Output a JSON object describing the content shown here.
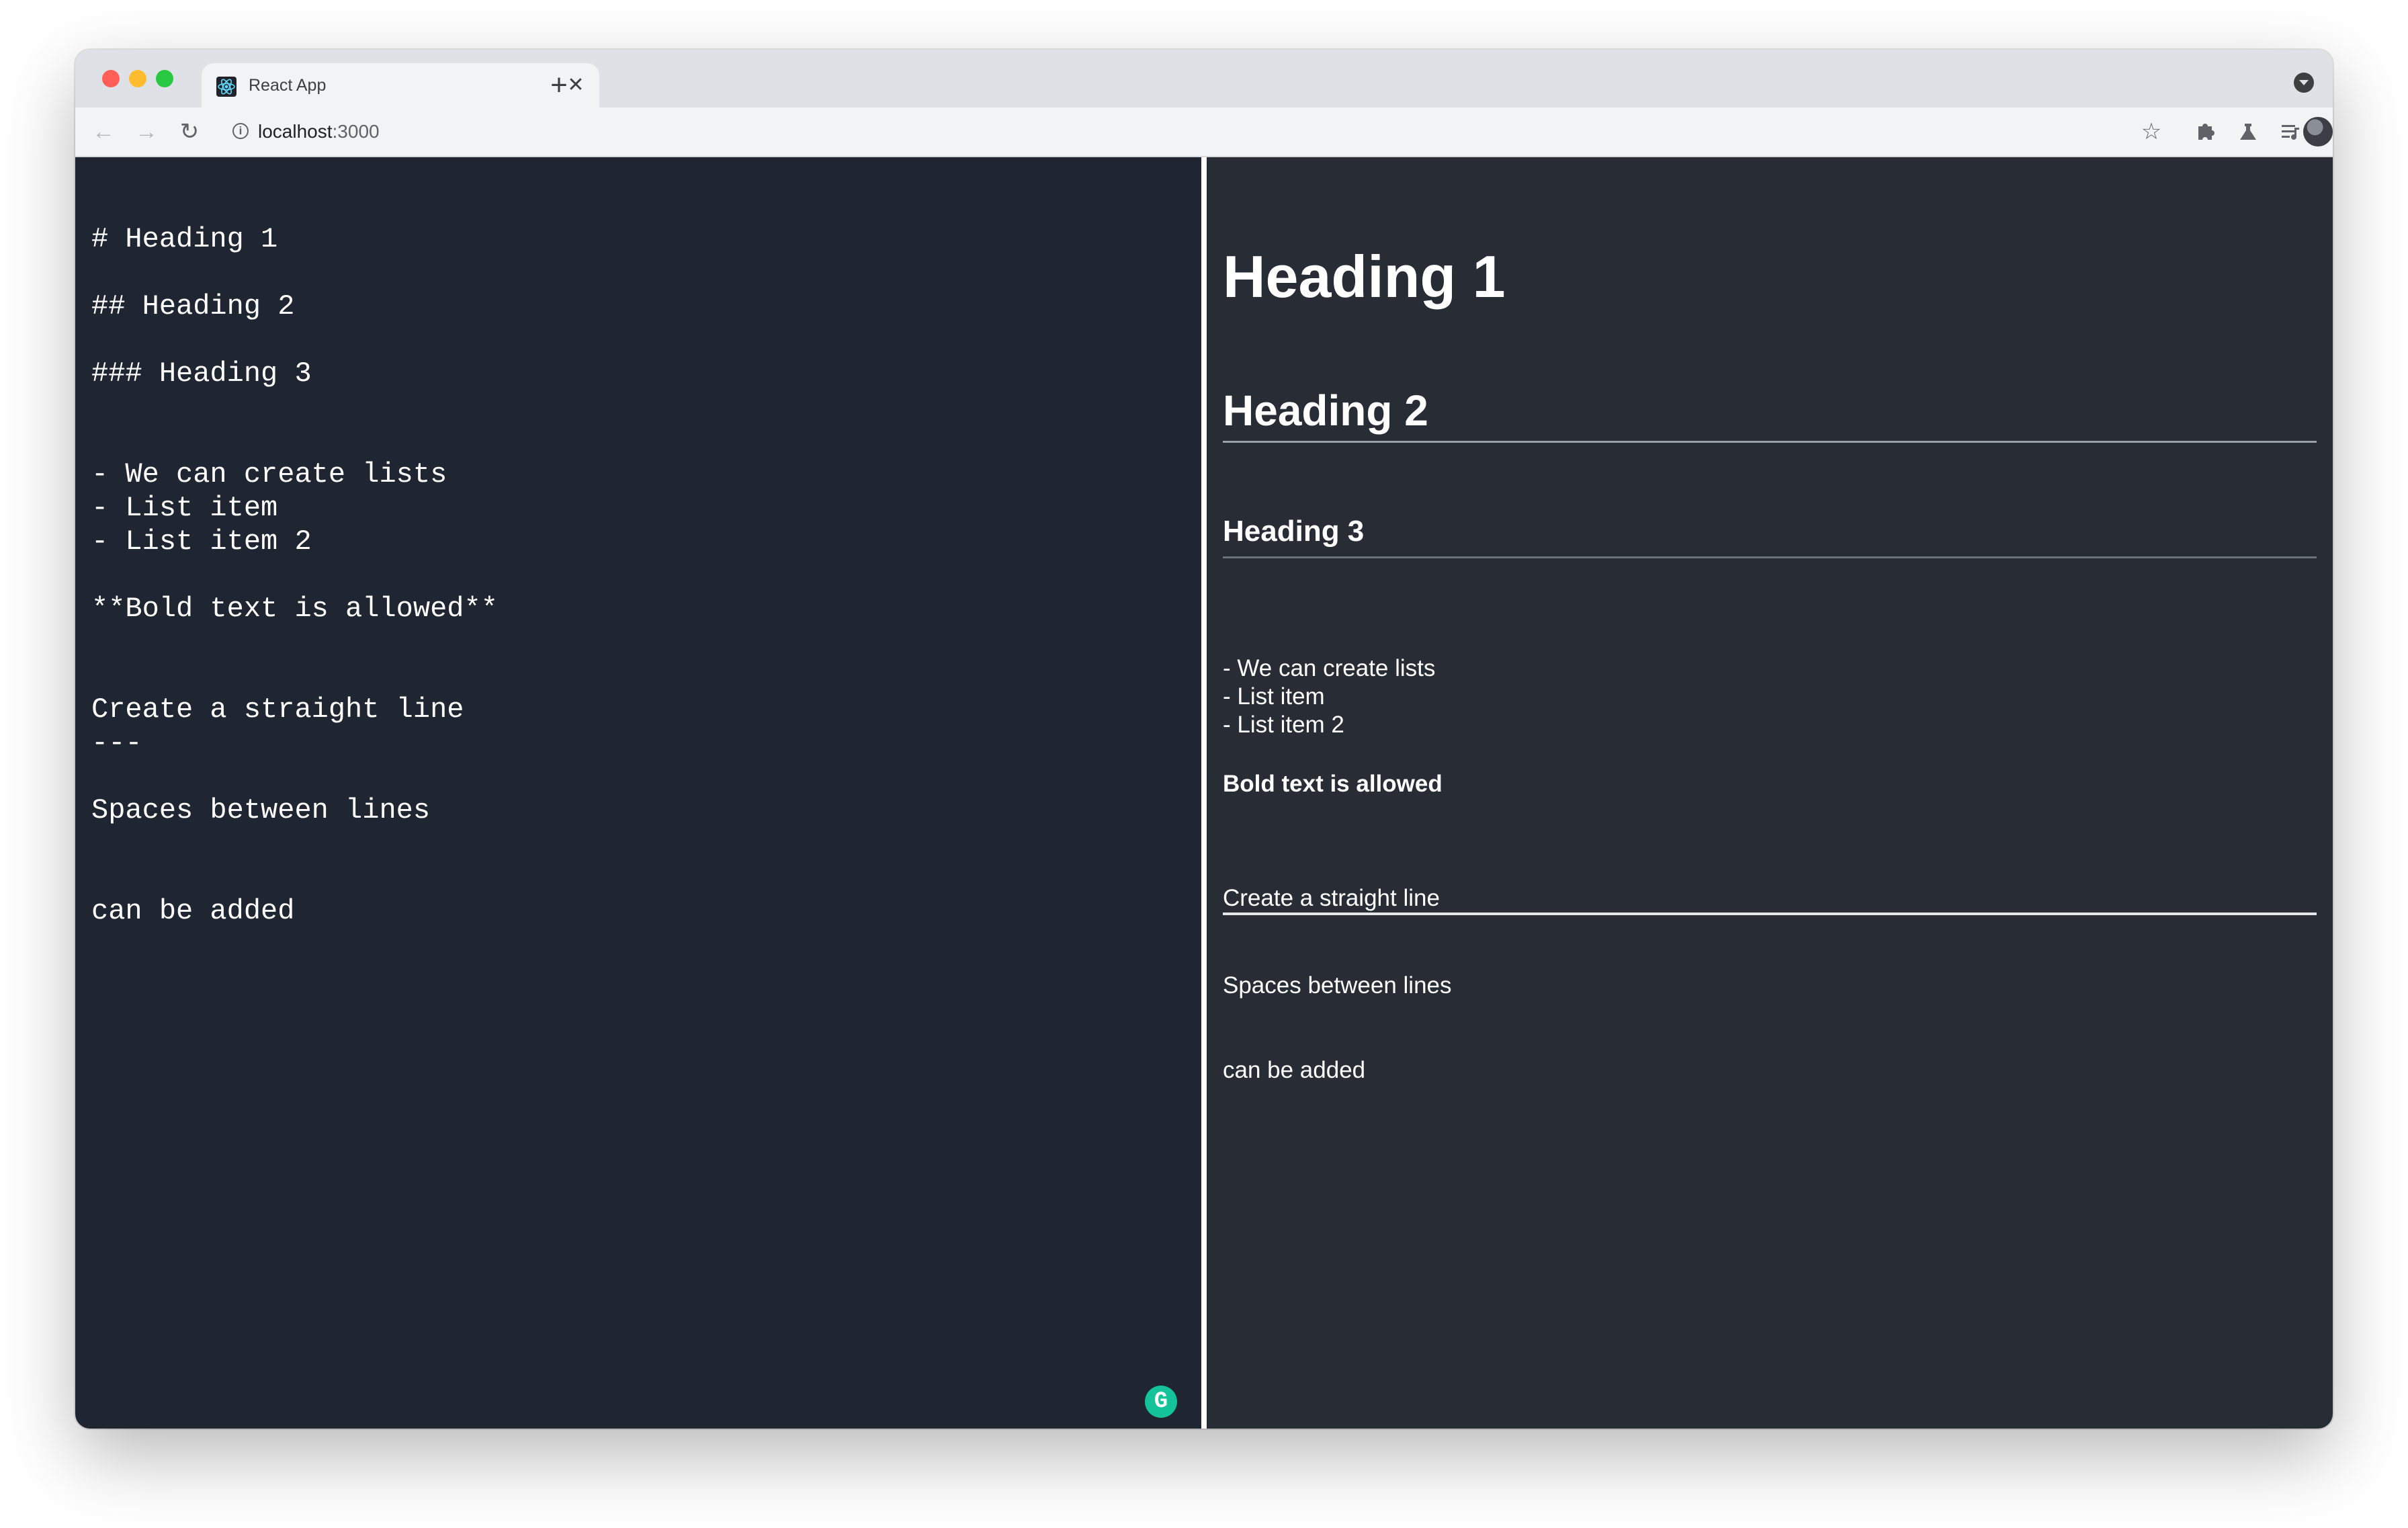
{
  "browser": {
    "tab_title": "React App",
    "tab_close": "✕",
    "new_tab": "+",
    "url_host": "localhost",
    "url_port": ":3000",
    "info_glyph": "i",
    "icons": {
      "back": "back-arrow-icon",
      "forward": "forward-arrow-icon",
      "reload": "reload-icon",
      "bookmark": "star-icon",
      "extensions": "puzzle-icon",
      "labs": "flask-icon",
      "reading_list": "reading-list-icon",
      "menu": "kebab-menu-icon"
    },
    "glyphs": {
      "back": "←",
      "forward": "→",
      "reload": "↻",
      "bookmark": "☆",
      "menu": "⋮"
    }
  },
  "editor": {
    "text": "# Heading 1\n\n## Heading 2\n\n### Heading 3\n\n\n- We can create lists\n- List item\n- List item 2\n\n**Bold text is allowed**\n\n\nCreate a straight line\n---\n\nSpaces between lines\n\n\ncan be added",
    "grammarly_glyph": "G"
  },
  "preview": {
    "h1": "Heading 1",
    "h2": "Heading 2",
    "h3": "Heading 3",
    "list_text": "- We can create lists\n- List item\n- List item 2",
    "bold": "Bold text is allowed",
    "line_text": "Create a straight line",
    "spaces": "Spaces between lines",
    "added": "can be added"
  },
  "colors": {
    "editor_bg": "#202532",
    "preview_bg": "#282c35",
    "grammarly": "#15c39a"
  }
}
